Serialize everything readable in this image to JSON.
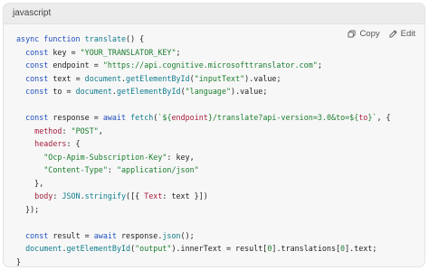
{
  "header": {
    "language": "javascript",
    "copy_label": "Copy",
    "edit_label": "Edit"
  },
  "code": {
    "lines": [
      "async function translate() {",
      "  const key = \"YOUR_TRANSLATOR_KEY\";",
      "  const endpoint = \"https://api.cognitive.microsofttranslator.com\";",
      "  const text = document.getElementById(\"inputText\").value;",
      "  const to = document.getElementById(\"language\").value;",
      "",
      "  const response = await fetch(`${endpoint}/translate?api-version=3.0&to=${to}`, {",
      "    method: \"POST\",",
      "    headers: {",
      "      \"Ocp-Apim-Subscription-Key\": key,",
      "      \"Content-Type\": \"application/json\"",
      "    },",
      "    body: JSON.stringify([{ Text: text }])",
      "  });",
      "",
      "  const result = await response.json();",
      "  document.getElementById(\"output\").innerText = result[0].translations[0].text;",
      "}"
    ]
  },
  "colors": {
    "keyword": "#1f4fbf",
    "string": "#1a7d2d",
    "function": "#0f7c8d",
    "property": "#a51f3b"
  }
}
